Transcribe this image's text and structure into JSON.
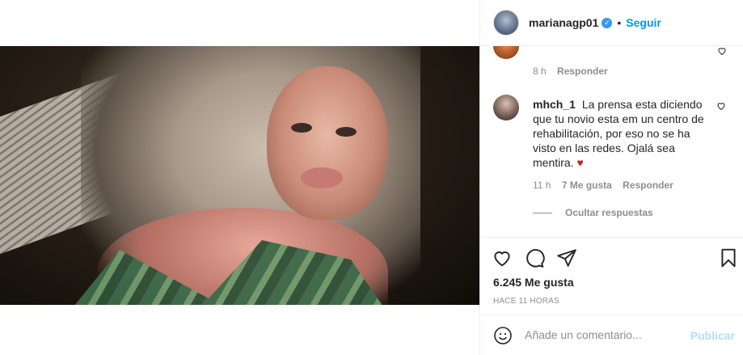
{
  "post": {
    "username": "marianagp01",
    "follow_label": "Seguir",
    "separator": "•",
    "verified_glyph": "✓"
  },
  "previous_comment": {
    "time": "8 h",
    "reply_label": "Responder",
    "like_icon": "heart-outline-icon"
  },
  "comment": {
    "username": "mhch_1",
    "text": "La prensa esta diciendo que tu novio esta em un centro de rehabilitación, por eso no se ha visto en las redes. Ojalá sea mentira.",
    "heart_emoji": "♥",
    "time": "11 h",
    "likes": "7 Me gusta",
    "reply_label": "Responder",
    "hide_replies": "Ocultar respuestas",
    "heart_color": "#c1272d"
  },
  "actions": {
    "like_icon": "heart-icon",
    "comment_icon": "comment-icon",
    "share_icon": "share-icon",
    "save_icon": "bookmark-icon",
    "likes_count": "6.245 Me gusta",
    "posted_time": "HACE 11 HORAS"
  },
  "add_comment": {
    "placeholder": "Añade un comentario...",
    "publish_label": "Publicar",
    "publish_color": "#b2dffc"
  },
  "colors": {
    "accent": "#0095f6",
    "muted": "#8e8e8e",
    "text": "#262626",
    "border": "#efefef"
  }
}
